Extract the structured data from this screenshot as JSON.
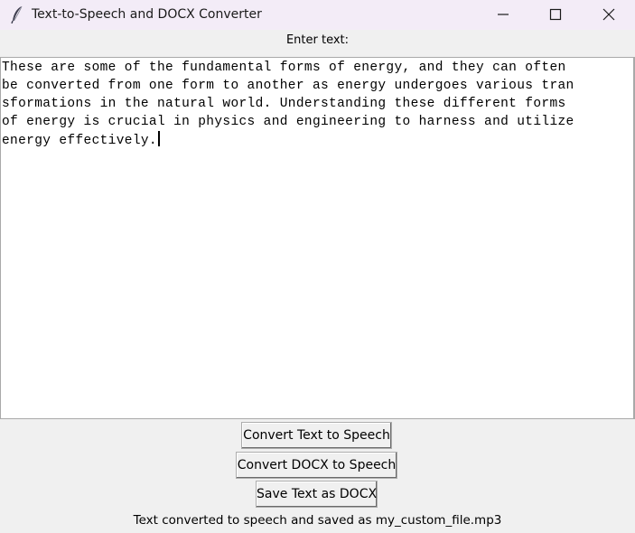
{
  "window": {
    "title": "Text-to-Speech and DOCX Converter",
    "icon": "feather-icon",
    "controls": [
      "minimize-icon",
      "maximize-icon",
      "close-icon"
    ]
  },
  "form": {
    "prompt_label": "Enter text:",
    "text_lines": [
      "These are some of the fundamental forms of energy, and they can often",
      "be converted from one form to another as energy undergoes various tran",
      "sformations in the natural world. Understanding these different forms",
      "of energy is crucial in physics and engineering to harness and utilize",
      "energy effectively."
    ]
  },
  "buttons": {
    "convert_text": "Convert Text to Speech",
    "convert_docx": "Convert DOCX to Speech",
    "save_docx": "Save Text as DOCX"
  },
  "status": {
    "message": "Text converted to speech and saved as my_custom_file.mp3"
  }
}
